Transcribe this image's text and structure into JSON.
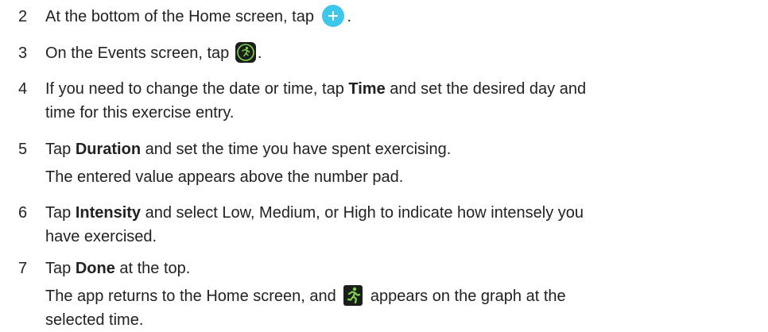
{
  "steps": [
    {
      "number": "2",
      "parts": [
        "At the bottom of the Home screen, tap",
        "."
      ]
    },
    {
      "number": "3",
      "parts": [
        "On the Events screen, tap",
        "."
      ]
    },
    {
      "number": "4",
      "line1": [
        "If you need to change the date or time, tap ",
        "Time",
        " and set the desired day and"
      ],
      "line2": "time for this exercise entry."
    },
    {
      "number": "5",
      "line1": [
        "Tap ",
        "Duration",
        " and set the time you have spent exercising."
      ],
      "result": "The entered value appears above the number pad."
    },
    {
      "number": "6",
      "line1": [
        "Tap ",
        "Intensity",
        " and select Low, Medium, or High to indicate how intensely you"
      ],
      "line2": "have exercised."
    },
    {
      "number": "7",
      "line1": [
        "Tap ",
        "Done",
        " at the top."
      ],
      "result1": [
        "The app returns to the Home screen, and",
        "appears on the graph at the"
      ],
      "result2": "selected time."
    }
  ],
  "icons": {
    "add": "plus-icon",
    "exercise_event": "exercise-icon",
    "graph_marker": "runner-icon",
    "accent_blue": "#3ec7ea",
    "accent_green": "#7fd44a"
  }
}
